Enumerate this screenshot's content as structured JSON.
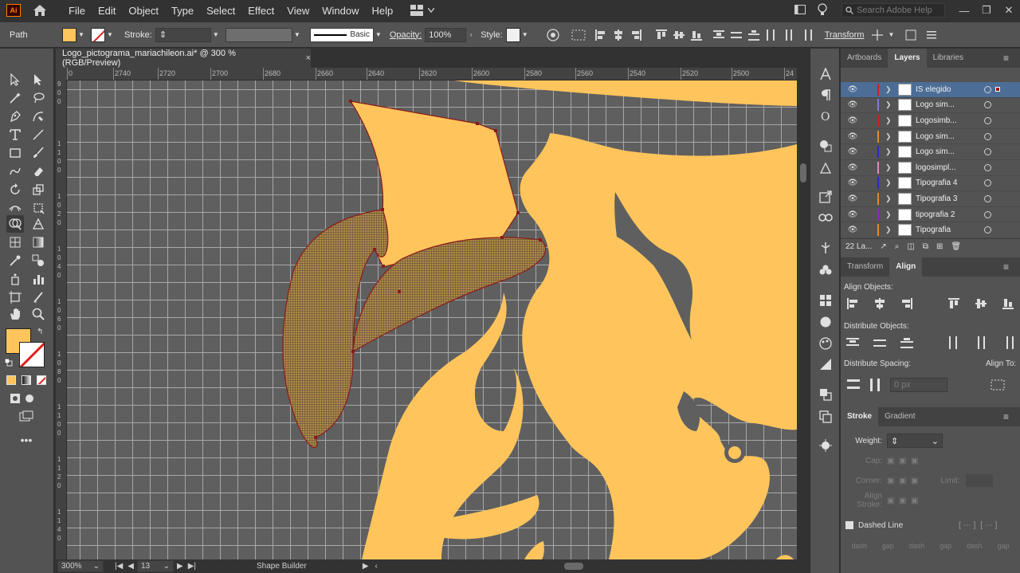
{
  "app": {
    "logo": "Ai",
    "home_icon": "home-icon"
  },
  "menu": [
    "File",
    "Edit",
    "Object",
    "Type",
    "Select",
    "Effect",
    "View",
    "Window",
    "Help"
  ],
  "search": {
    "placeholder": "Search Adobe Help"
  },
  "control": {
    "selection_type": "Path",
    "stroke_label": "Stroke:",
    "brush_label": "Basic",
    "opacity_label": "Opacity:",
    "opacity_value": "100%",
    "style_label": "Style:",
    "transform_label": "Transform"
  },
  "document": {
    "tab_title": "Logo_pictograma_mariachileon.ai* @ 300 % (RGB/Preview)",
    "close": "×"
  },
  "ruler": {
    "h_labels": [
      "0",
      "2740",
      "2720",
      "2700",
      "2680",
      "2660",
      "2640",
      "2620",
      "2600",
      "2580",
      "2560",
      "2540",
      "2520",
      "2500",
      "24"
    ],
    "v_groups": [
      [
        "9",
        "0",
        "0"
      ],
      [
        "1",
        "1",
        "0",
        "0"
      ],
      [
        "1",
        "0",
        "2",
        "0"
      ],
      [
        "1",
        "0",
        "4",
        "0"
      ],
      [
        "1",
        "0",
        "6",
        "0"
      ],
      [
        "1",
        "0",
        "8",
        "0"
      ],
      [
        "1",
        "1",
        "0",
        "0"
      ],
      [
        "1",
        "1",
        "2",
        "0"
      ],
      [
        "1",
        "1",
        "4",
        "0"
      ]
    ]
  },
  "status": {
    "zoom": "300%",
    "artboard": "13",
    "tool_name": "Shape Builder"
  },
  "colors": {
    "fill": "#ffc55c",
    "stroke_none_slash": "#e0201c",
    "selection_path": "#8b1a1a",
    "canvas": "#5f5f5f",
    "layer_selected": "#4b6d96"
  },
  "panels": {
    "layers_tabs": [
      "Artboards",
      "Layers",
      "Libraries"
    ],
    "layers": [
      {
        "name": "IS elegido",
        "color": "#c22",
        "selected": true
      },
      {
        "name": "Logo sim...",
        "color": "#7b7bdc"
      },
      {
        "name": "Logosimb...",
        "color": "#c22"
      },
      {
        "name": "Logo sim...",
        "color": "#e08a2a"
      },
      {
        "name": "Logo sim...",
        "color": "#2a2ac0"
      },
      {
        "name": "logosimpl...",
        "color": "#e08ac0"
      },
      {
        "name": "Tipografia 4",
        "color": "#2a2ac0"
      },
      {
        "name": "Tipografia 3",
        "color": "#e08a2a"
      },
      {
        "name": "tipografia 2",
        "color": "#8a2ac0"
      },
      {
        "name": "Tipografia",
        "color": "#e08a2a"
      }
    ],
    "layers_count": "22 La...",
    "align_tabs": [
      "Transform",
      "Align"
    ],
    "align_objects": "Align Objects:",
    "distribute_objects": "Distribute Objects:",
    "distribute_spacing": "Distribute Spacing:",
    "align_to": "Align To:",
    "spacing_value": "0 px",
    "stroke_tabs": [
      "Stroke",
      "Gradient"
    ],
    "weight_label": "Weight:",
    "cap_label": "Cap:",
    "corner_label": "Corner:",
    "limit_label": "Limit:",
    "align_stroke_label": "Align Stroke:",
    "dashed_line_label": "Dashed Line",
    "dash_labels": [
      "dash",
      "gap",
      "dash",
      "gap",
      "dash",
      "gap"
    ]
  }
}
